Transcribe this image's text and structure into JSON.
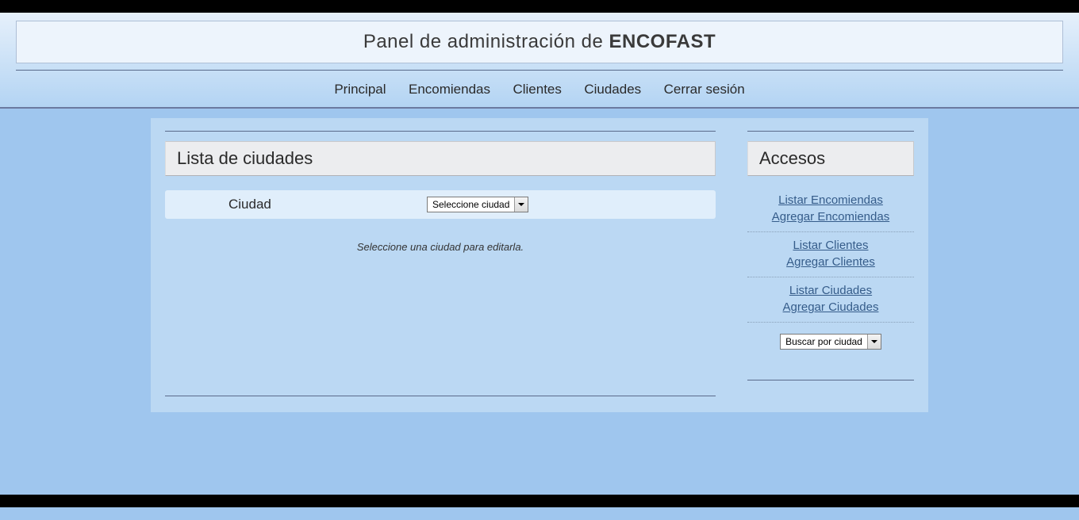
{
  "header": {
    "title_prefix": "Panel de administración de ",
    "title_bold": "ENCOFAST"
  },
  "nav": {
    "items": [
      "Principal",
      "Encomiendas",
      "Clientes",
      "Ciudades",
      "Cerrar sesión"
    ]
  },
  "main": {
    "heading": "Lista de ciudades",
    "form": {
      "city_label": "Ciudad",
      "city_select_value": "Seleccione ciudad"
    },
    "hint": "Seleccione una ciudad para editarla."
  },
  "sidebar": {
    "heading": "Accesos",
    "groups": [
      {
        "links": [
          "Listar Encomiendas",
          "Agregar Encomiendas"
        ]
      },
      {
        "links": [
          "Listar Clientes",
          "Agregar Clientes"
        ]
      },
      {
        "links": [
          "Listar Ciudades",
          "Agregar Ciudades"
        ]
      }
    ],
    "search_select_value": "Buscar por ciudad"
  }
}
